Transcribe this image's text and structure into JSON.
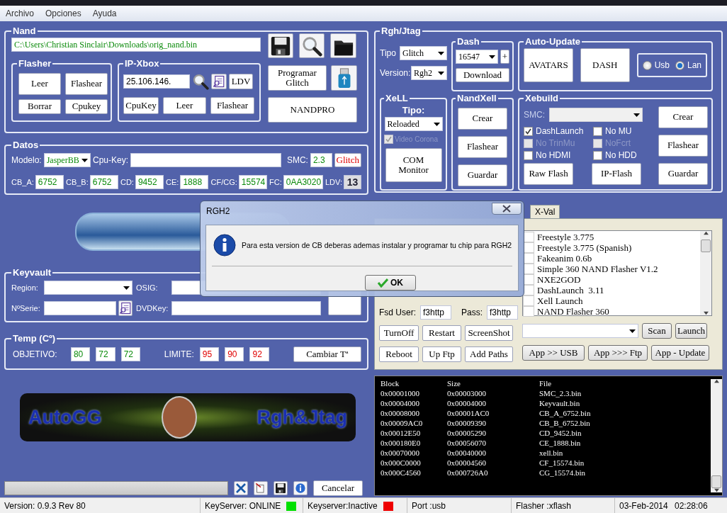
{
  "menu": [
    "Archivo",
    "Opciones",
    "Ayuda"
  ],
  "nand": {
    "title": "Nand",
    "path": "C:\\Users\\Christian Sinclair\\Downloads\\orig_nand.bin",
    "flasher": {
      "title": "Flasher",
      "buttons": [
        "Leer",
        "Flashear",
        "Borrar",
        "Cpukey"
      ]
    },
    "ip_xbox": {
      "title": "IP-Xbox",
      "ip": "25.106.146.",
      "ldv": "LDV",
      "buttons": [
        "CpuKey",
        "Leer",
        "Flashear"
      ]
    },
    "program": "Programar Glitch",
    "nandpro": "NANDPRO"
  },
  "datos": {
    "title": "Datos",
    "modelo": {
      "label": "Modelo:",
      "value": "JasperBB"
    },
    "cpu_key": {
      "label": "Cpu-Key:"
    },
    "smc": {
      "label": "SMC:",
      "value": "2.3"
    },
    "glitch": "Glitch",
    "values": [
      {
        "label": "CB_A:",
        "value": "6752"
      },
      {
        "label": "CB_B:",
        "value": "6752"
      },
      {
        "label": "CD:",
        "value": "9452"
      },
      {
        "label": "CE:",
        "value": "1888"
      },
      {
        "label": "CF/CG:",
        "value": "15574"
      },
      {
        "label": "FC:",
        "value": "0AA3020"
      }
    ],
    "ldv": {
      "label": "LDV:",
      "value": "13"
    }
  },
  "keyvault": {
    "title": "Keyvault",
    "region": {
      "label": "Region:"
    },
    "osig": {
      "label": "OSIG:"
    },
    "serial": {
      "label": "NºSerie:"
    },
    "dvdkey": {
      "label": "DVDKey:"
    }
  },
  "temp": {
    "title": "Temp (Cº)",
    "objetivo": {
      "label": "OBJETIVO:",
      "values": [
        "80",
        "72",
        "72"
      ]
    },
    "limite": {
      "label": "LIMITE:",
      "values": [
        "95",
        "90",
        "92"
      ]
    },
    "button": "Cambiar Tª"
  },
  "banner": {
    "left": "AutoGG",
    "right": "Rgh&Jtag"
  },
  "progress": {
    "level": 0
  },
  "cancel": "Cancelar",
  "rgh": {
    "title": "Rgh/Jtag",
    "tipo": {
      "label": "Tipo",
      "value": "Glitch"
    },
    "version": {
      "label": "Version:",
      "value": "Rgh2"
    },
    "dash": {
      "title": "Dash",
      "value": "16547",
      "plus": "+",
      "download": "Download"
    },
    "auto_update": {
      "title": "Auto-Update",
      "buttons": [
        "AVATARS",
        "DASH"
      ],
      "radios": [
        {
          "label": "Usb",
          "selected": false
        },
        {
          "label": "Lan",
          "selected": true
        }
      ]
    },
    "xell": {
      "title": "XeLL",
      "tipo_label": "Tipo:",
      "value": "Reloaded",
      "video_corona": {
        "label": "Video Corona",
        "checked": true,
        "disabled": true
      },
      "com_monitor": "COM Monitor"
    },
    "nandxell": {
      "title": "NandXell",
      "buttons": [
        "Crear",
        "Flashear",
        "Guardar"
      ]
    },
    "xebuild": {
      "title": "Xebuild",
      "smc_label": "SMC:",
      "options": [
        {
          "label": "DashLaunch",
          "checked": true,
          "disabled": false
        },
        {
          "label": "No MU",
          "checked": false,
          "disabled": false
        },
        {
          "label": "No TrinMu",
          "checked": false,
          "disabled": true
        },
        {
          "label": "NoFcrt",
          "checked": false,
          "disabled": true
        },
        {
          "label": "No HDMI",
          "checked": false,
          "disabled": false
        },
        {
          "label": "No HDD",
          "checked": false,
          "disabled": false
        }
      ],
      "buttons_left": [
        "Raw Flash",
        "IP-Flash"
      ],
      "buttons_right": [
        "Crear",
        "Flashear",
        "Guardar"
      ]
    }
  },
  "tools": {
    "tabs": [
      {
        "label": "X-Val",
        "selected": false
      }
    ],
    "fsd_user": {
      "label": "Fsd User:",
      "value": "f3http"
    },
    "pass": {
      "label": "Pass:",
      "value": "f3http"
    },
    "buttons": [
      "TurnOff",
      "Restart",
      "ScreenShot",
      "Reboot",
      "Up Ftp",
      "Add Paths"
    ],
    "apps": [
      {
        "label": "Freestyle 3.775",
        "checked": false
      },
      {
        "label": "Freestyle 3.775 (Spanish)",
        "checked": false
      },
      {
        "label": "Fakeanim 0.6b",
        "checked": false
      },
      {
        "label": "Simple 360 NAND Flasher V1.2",
        "checked": false
      },
      {
        "label": "NXE2GOD",
        "checked": false
      },
      {
        "label": "DashLaunch  3.11",
        "checked": false
      },
      {
        "label": "Xell Launch",
        "checked": false
      },
      {
        "label": "NAND Flasher 360",
        "checked": false
      }
    ],
    "scan": "Scan",
    "launch": "Launch",
    "app_buttons": [
      "App >> USB",
      "App >>> Ftp",
      "App - Update"
    ]
  },
  "console": {
    "columns": [
      "Block",
      "Size",
      "File"
    ],
    "rows": [
      [
        "0x00001000",
        "0x00003000",
        "SMC_2.3.bin"
      ],
      [
        "0x00004000",
        "0x00004000",
        "Keyvault.bin"
      ],
      [
        "0x00008000",
        "0x00001AC0",
        "CB_A_6752.bin"
      ],
      [
        "0x00009AC0",
        "0x00009390",
        "CB_B_6752.bin"
      ],
      [
        "0x00012E50",
        "0x00005290",
        "CD_9452.bin"
      ],
      [
        "0x000180E0",
        "0x00056070",
        "CE_1888.bin"
      ],
      [
        "0x00070000",
        "0x00040000",
        "xell.bin"
      ],
      [
        "0x000C0000",
        "0x00004560",
        "CF_15574.bin"
      ],
      [
        "0x000C4560",
        "0x000726A0",
        "CG_15574.bin"
      ]
    ]
  },
  "status": {
    "version": "Version: 0.9.3 Rev 80",
    "servers": [
      {
        "text": "KeyServer: ONLINE",
        "color": "#00e000"
      },
      {
        "text": "Keyserver:Inactive",
        "color": "#ee0000"
      }
    ],
    "port": "Port :usb",
    "flasher": "Flasher :xflash",
    "date": "03-Feb-2014",
    "time": "02:28:06"
  },
  "dialog": {
    "title": "RGH2",
    "message": "Para esta version de CB deberas ademas instalar y programar tu chip para RGH2",
    "ok": "OK"
  }
}
